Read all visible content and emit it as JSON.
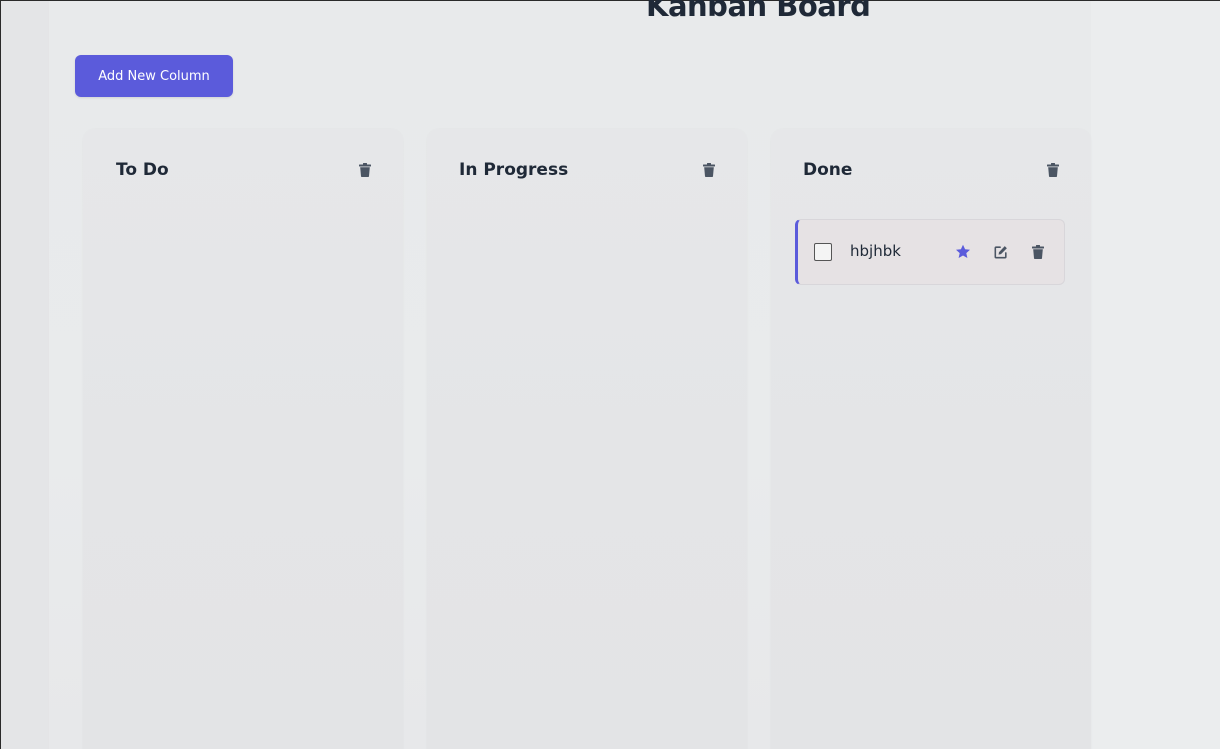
{
  "page": {
    "title": "Kanban Board",
    "add_column_label": "Add New Column"
  },
  "columns": [
    {
      "title": "To Do",
      "cards": []
    },
    {
      "title": "In Progress",
      "cards": []
    },
    {
      "title": "Done",
      "cards": [
        {
          "text": "hbjhbk",
          "starred": true,
          "completed": false
        }
      ]
    }
  ],
  "icons": {
    "column_delete": "trash-icon",
    "card_star": "star-icon",
    "card_edit": "edit-icon",
    "card_delete": "trash-icon"
  },
  "colors": {
    "accent": "#5b5bdb",
    "text": "#1f2937",
    "icon": "#4b5563"
  }
}
